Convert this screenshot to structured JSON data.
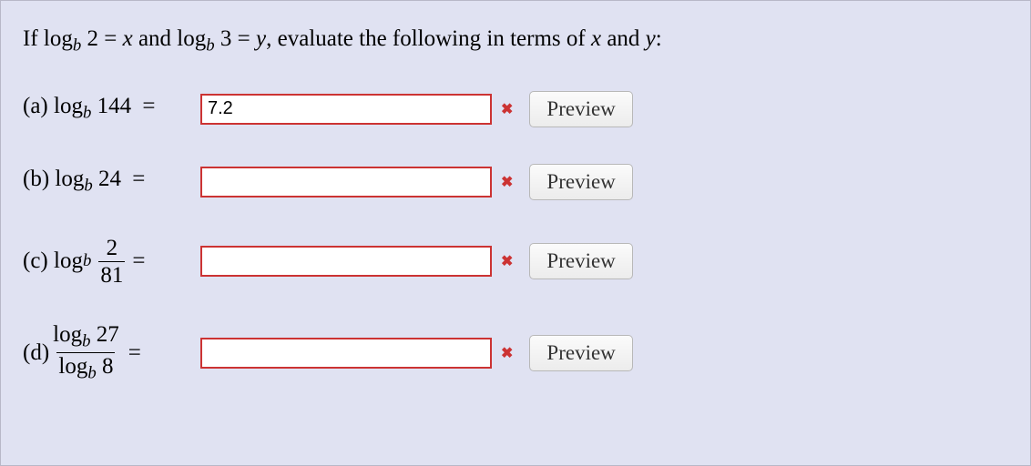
{
  "prompt": {
    "prefix": "If log",
    "sub1": "b",
    "arg1": " 2 = ",
    "var1": "x",
    "mid1": " and log",
    "sub2": "b",
    "arg2": " 3 = ",
    "var2": "y",
    "suffix": ", evaluate the following in terms of ",
    "varx": "x",
    "and": " and ",
    "vary": "y",
    "colon": ":"
  },
  "parts": {
    "a": {
      "letter": "(a) log",
      "sub": "b",
      "arg": " 144",
      "eq": "  =  ",
      "value": "7.2",
      "preview": "Preview"
    },
    "b": {
      "letter": "(b) log",
      "sub": "b",
      "arg": " 24",
      "eq": "  =  ",
      "value": "",
      "preview": "Preview"
    },
    "c": {
      "letter": "(c) log",
      "sub": "b",
      "frac_num": "2",
      "frac_den": "81",
      "eq": "  =  ",
      "value": "",
      "preview": "Preview"
    },
    "d": {
      "letter": "(d) ",
      "num_log": "log",
      "num_sub": "b",
      "num_arg": " 27",
      "den_log": "log",
      "den_sub": "b",
      "den_arg": " 8",
      "eq": "  =  ",
      "value": "",
      "preview": "Preview"
    }
  }
}
